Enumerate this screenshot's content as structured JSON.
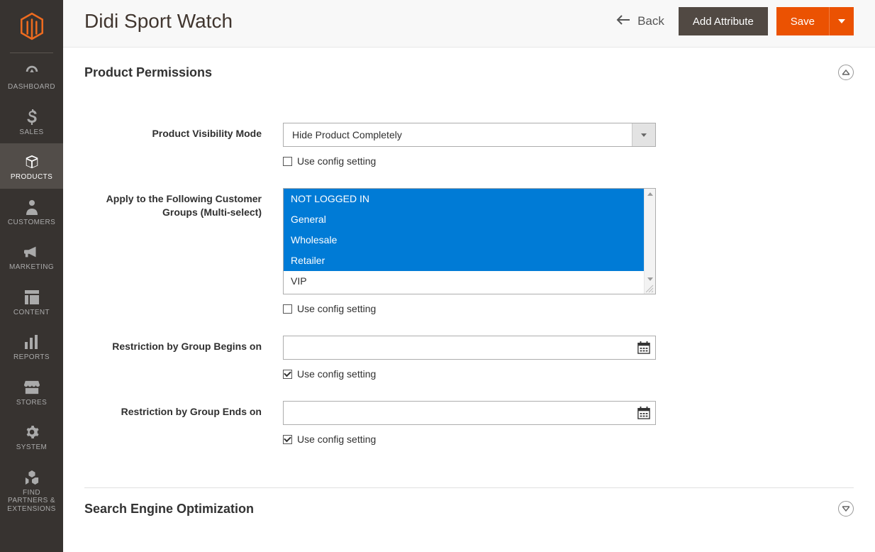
{
  "header": {
    "title": "Didi Sport Watch",
    "back_label": "Back",
    "add_attribute_label": "Add Attribute",
    "save_label": "Save"
  },
  "sidebar": {
    "items": [
      {
        "label": "DASHBOARD",
        "icon": "dashboard"
      },
      {
        "label": "SALES",
        "icon": "dollar"
      },
      {
        "label": "PRODUCTS",
        "icon": "box",
        "active": true
      },
      {
        "label": "CUSTOMERS",
        "icon": "person"
      },
      {
        "label": "MARKETING",
        "icon": "megaphone"
      },
      {
        "label": "CONTENT",
        "icon": "layout"
      },
      {
        "label": "REPORTS",
        "icon": "bars"
      },
      {
        "label": "STORES",
        "icon": "storefront"
      },
      {
        "label": "SYSTEM",
        "icon": "gear"
      },
      {
        "label": "FIND PARTNERS & EXTENSIONS",
        "icon": "blocks"
      }
    ]
  },
  "section1": {
    "title": "Product Permissions",
    "visibility_label": "Product Visibility Mode",
    "visibility_value": "Hide Product Completely",
    "use_config_label": "Use config setting",
    "groups_label": "Apply to the Following Customer Groups (Multi-select)",
    "groups": [
      {
        "label": "NOT LOGGED IN",
        "selected": true
      },
      {
        "label": "General",
        "selected": true
      },
      {
        "label": "Wholesale",
        "selected": true
      },
      {
        "label": "Retailer",
        "selected": true
      },
      {
        "label": "VIP",
        "selected": false
      }
    ],
    "begins_label": "Restriction by Group Begins on",
    "ends_label": "Restriction by Group Ends on",
    "begins_value": "",
    "ends_value": "",
    "visibility_use_config": false,
    "groups_use_config": false,
    "begins_use_config": true,
    "ends_use_config": true
  },
  "section2": {
    "title": "Search Engine Optimization"
  }
}
